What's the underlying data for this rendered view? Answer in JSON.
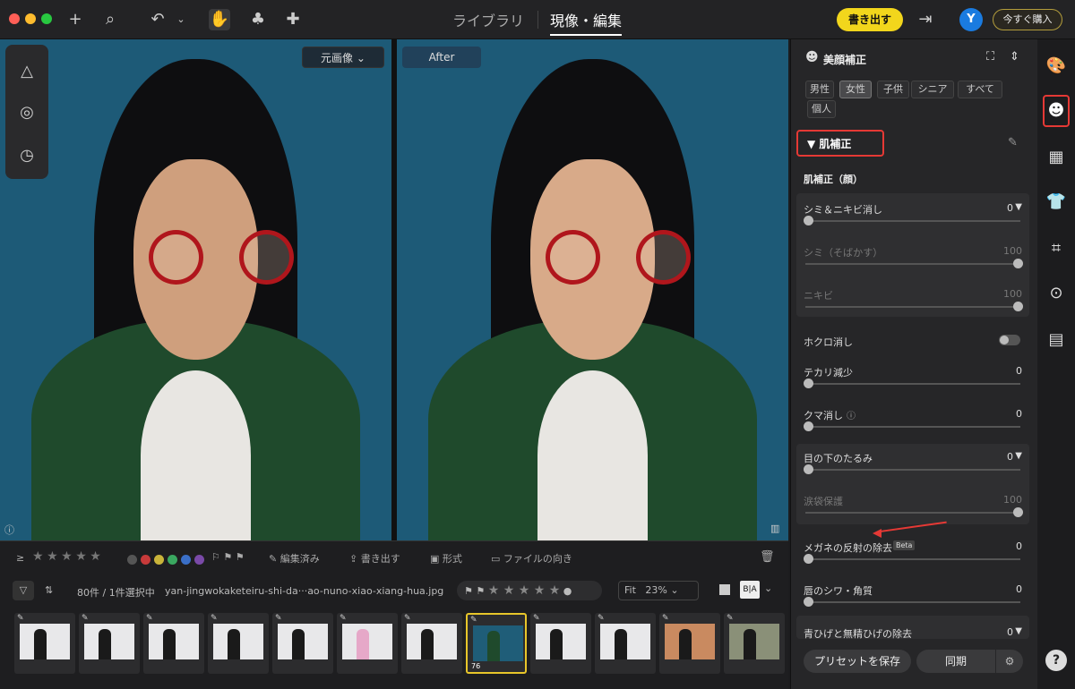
{
  "titlebar": {
    "tabs": [
      "ライブラリ",
      "現像・編集"
    ],
    "export_label": "書き出す",
    "buy_label": "今すぐ購入",
    "avatar_letter": "Y"
  },
  "viewer": {
    "original_label": "元画像",
    "after_label": "After"
  },
  "filmstrip": {
    "toolbar": {
      "ge_symbol": "≥",
      "edited_label": "編集済み",
      "export_label": "書き出す",
      "format_label": "形式",
      "orientation_label": "ファイルの向き"
    },
    "count_label": "80件 / 1件選択中",
    "filename": "yan-jingwokaketeiru-shi-da···ao-nuno-xiao-xiang-hua.jpg",
    "fit_label": "Fit",
    "zoom": "23%",
    "compare_label": "B|A",
    "selected_number": "76"
  },
  "panel": {
    "title": "美顔補正",
    "segments": [
      "男性",
      "女性",
      "子供",
      "シニア",
      "すべて",
      "個人"
    ],
    "section_title": "肌補正",
    "subsection_face": "肌補正（顔）",
    "sliders": [
      {
        "label": "シミ＆ニキビ消し",
        "value": "0"
      },
      {
        "label": "シミ（そばかす）",
        "value": "100"
      },
      {
        "label": "ニキビ",
        "value": "100"
      },
      {
        "label": "ホクロ消し",
        "value": ""
      },
      {
        "label": "テカリ減少",
        "value": "0"
      },
      {
        "label": "クマ消し",
        "value": "0"
      },
      {
        "label": "目の下のたるみ",
        "value": "0"
      },
      {
        "label": "涙袋保護",
        "value": "100"
      },
      {
        "label": "メガネの反射の除去",
        "value": "0"
      },
      {
        "label": "唇のシワ・角質",
        "value": "0"
      },
      {
        "label": "青ひげと無精ひげの除去",
        "value": "0"
      }
    ],
    "beta_label": "Beta",
    "save_preset_label": "プリセットを保存",
    "sync_label": "同期"
  },
  "rail": {
    "help_label": "?"
  },
  "colors": {
    "accent_yellow": "#f2d61c",
    "highlight_red": "#e53935",
    "avatar_blue": "#1a7be0"
  }
}
